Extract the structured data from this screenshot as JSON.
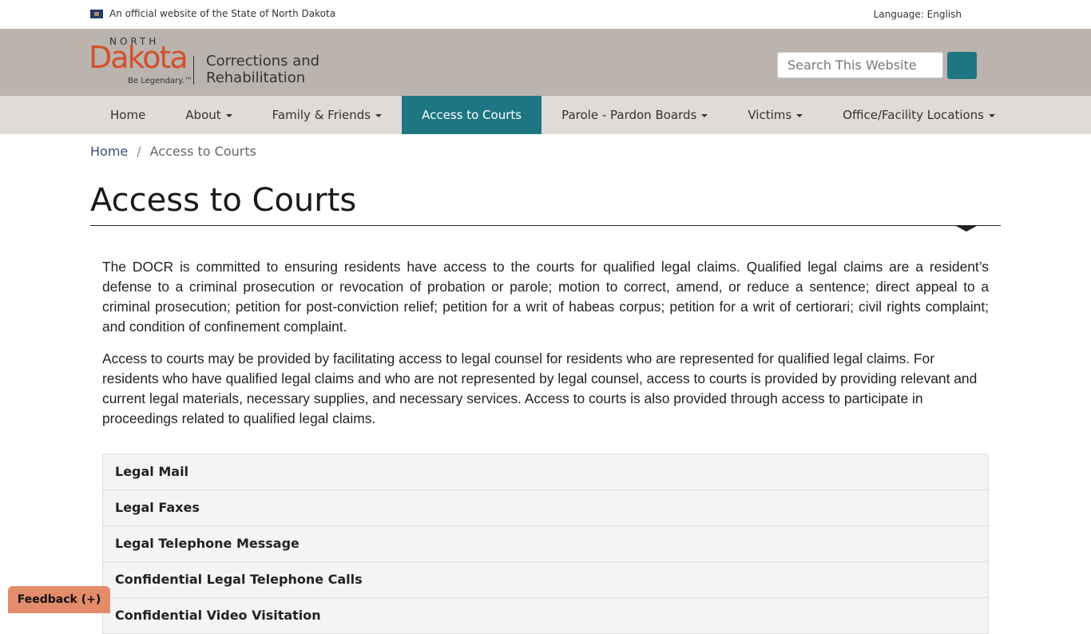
{
  "official_bar": {
    "text": "An official website of the State of North Dakota",
    "language": "Language: English"
  },
  "header": {
    "logo_north": "NORTH",
    "logo_dakota": "Dakota",
    "logo_tagline": "Be Legendary.™",
    "department": "Corrections and Rehabilitation",
    "search_placeholder": "Search This Website"
  },
  "nav": {
    "items": [
      {
        "label": "Home",
        "dropdown": false,
        "active": false
      },
      {
        "label": "About",
        "dropdown": true,
        "active": false
      },
      {
        "label": "Family & Friends",
        "dropdown": true,
        "active": false
      },
      {
        "label": "Access to Courts",
        "dropdown": false,
        "active": true
      },
      {
        "label": "Parole - Pardon Boards",
        "dropdown": true,
        "active": false
      },
      {
        "label": "Victims",
        "dropdown": true,
        "active": false
      },
      {
        "label": "Office/Facility Locations",
        "dropdown": true,
        "active": false
      }
    ]
  },
  "breadcrumb": {
    "home": "Home",
    "separator": "/",
    "current": "Access to Courts"
  },
  "page": {
    "title": "Access to Courts",
    "paragraph1": "The DOCR is committed to ensuring residents have access to the courts for qualified legal claims. Qualified legal claims are a resident’s defense to a criminal prosecution or revocation of probation or parole; motion to correct, amend, or reduce a sentence; direct appeal to a criminal prosecution; petition for post-conviction relief; petition for a writ of habeas corpus; petition for a writ of certiorari; civil rights complaint; and condition of confinement complaint.",
    "paragraph2": "Access to courts may be provided by facilitating access to legal counsel for residents who are represented for qualified legal claims. For residents who have qualified legal claims and who are not represented by legal counsel, access to courts is provided by providing relevant and current legal materials, necessary supplies, and necessary services. Access to courts is also provided through access to participate in proceedings related to qualified legal claims."
  },
  "accordion": {
    "items": [
      "Legal Mail",
      "Legal Faxes",
      "Legal Telephone Message",
      "Confidential Legal Telephone Calls",
      "Confidential Video Visitation"
    ]
  },
  "feedback": {
    "label": "Feedback (+)"
  },
  "colors": {
    "header_bg": "#bbb3ad",
    "nav_bg": "#e0dbd6",
    "accent": "#1d7682",
    "logo_red": "#d2502e",
    "feedback_bg": "#e38c6b"
  }
}
